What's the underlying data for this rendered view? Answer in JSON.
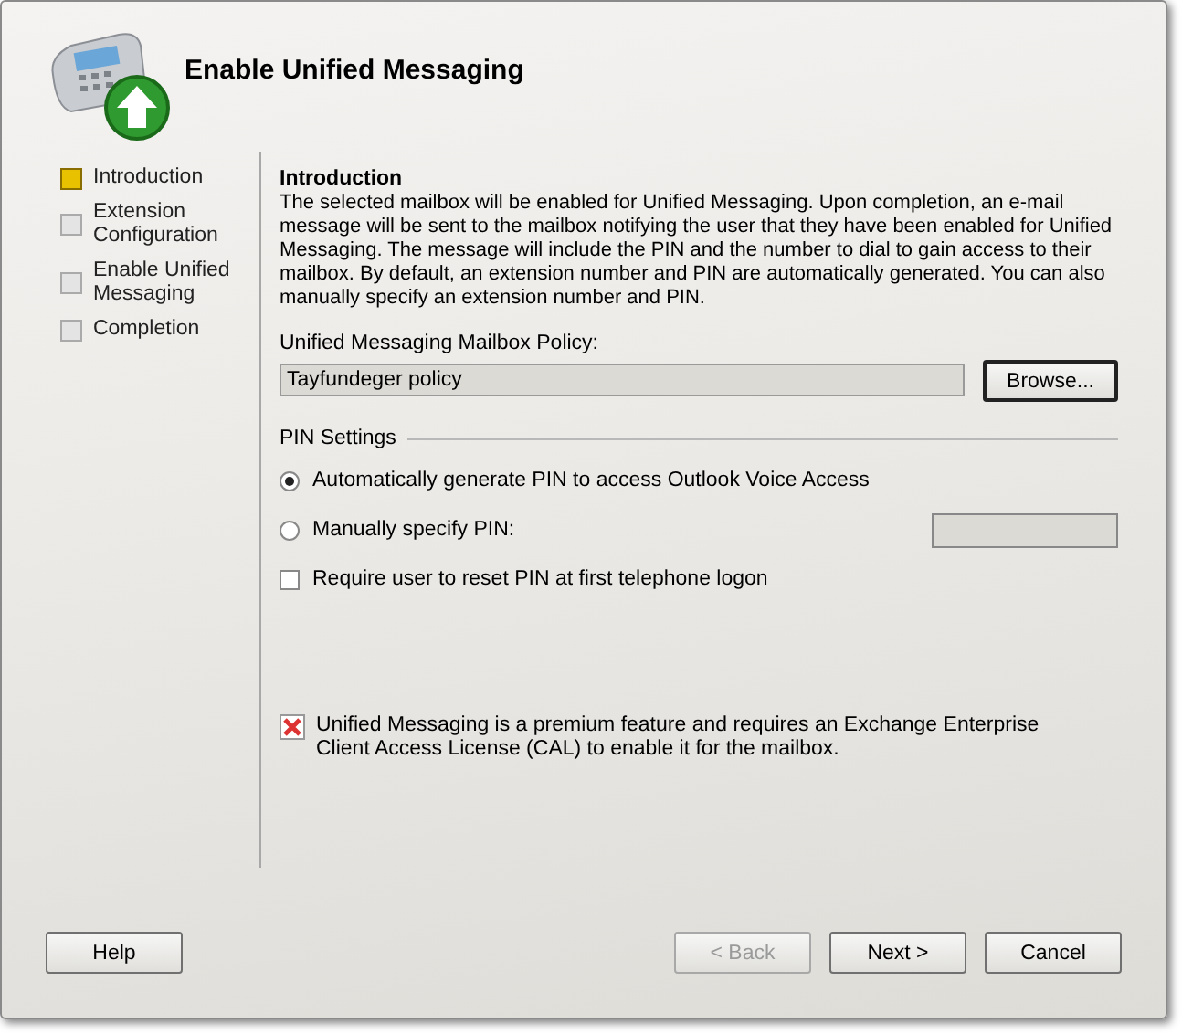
{
  "window": {
    "title": "Enable Unified Messaging"
  },
  "steps": [
    {
      "label": "Introduction",
      "selected": true
    },
    {
      "label": "Extension Configuration",
      "selected": false
    },
    {
      "label": "Enable Unified Messaging",
      "selected": false
    },
    {
      "label": "Completion",
      "selected": false
    }
  ],
  "content": {
    "heading": "Introduction",
    "description": "The selected mailbox will be enabled for Unified Messaging. Upon completion, an e-mail message will be sent to the mailbox notifying the user that they have been enabled for Unified Messaging. The message will include the PIN and the number to dial to gain access to their mailbox. By default, an extension number and PIN are automatically generated. You can also manually specify an extension number and PIN.",
    "policy_label": "Unified Messaging Mailbox Policy:",
    "policy_value": "Tayfundeger policy",
    "browse_button": "Browse...",
    "pin_section": "PIN Settings",
    "pin_options": [
      {
        "label": "Automatically generate PIN to access Outlook Voice Access",
        "selected": true
      },
      {
        "label": "Manually specify PIN:",
        "selected": false
      }
    ],
    "pin_field": {
      "disabled": true
    },
    "reset_checkbox": {
      "label": "Require user to reset PIN at first telephone logon",
      "checked": false
    },
    "notice": "Unified Messaging is a premium feature and requires an Exchange Enterprise Client Access License (CAL) to enable it for the mailbox."
  },
  "buttons": [
    {
      "label": "Help",
      "disabled": false
    },
    {
      "label": "< Back",
      "disabled": true
    },
    {
      "label": "Next >",
      "disabled": false
    },
    {
      "label": "Cancel",
      "disabled": false
    }
  ]
}
